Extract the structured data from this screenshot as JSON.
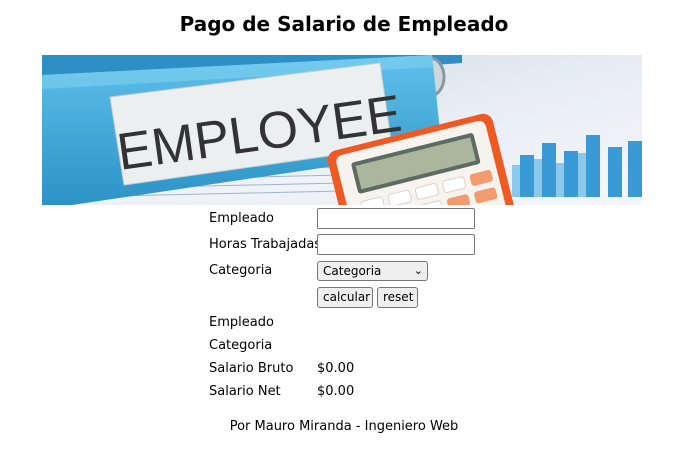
{
  "page": {
    "title": "Pago de Salario de Empleado"
  },
  "banner": {
    "binder_label": "EMPLOYEE"
  },
  "form": {
    "empleado_label": "Empleado",
    "empleado_value": "",
    "horas_label": "Horas Trabajadas",
    "horas_value": "",
    "categoria_label": "Categoria",
    "categoria_selected": "Categoria",
    "calcular_label": "calcular",
    "reset_label": "reset"
  },
  "results": {
    "empleado_label": "Empleado",
    "empleado_value": "",
    "categoria_label": "Categoria",
    "categoria_value": "",
    "bruto_label": "Salario Bruto",
    "bruto_value": "$0.00",
    "neto_label": "Salario Net",
    "neto_value": "$0.00"
  },
  "footer": {
    "text": "Por Mauro Miranda - Ingeniero Web"
  },
  "icons": {
    "dropdown": "chevron-down-icon"
  },
  "colors": {
    "binder_blue": "#3aa5d6",
    "calculator_orange": "#ef5a24",
    "chart_blue": "#2a8fd0"
  }
}
